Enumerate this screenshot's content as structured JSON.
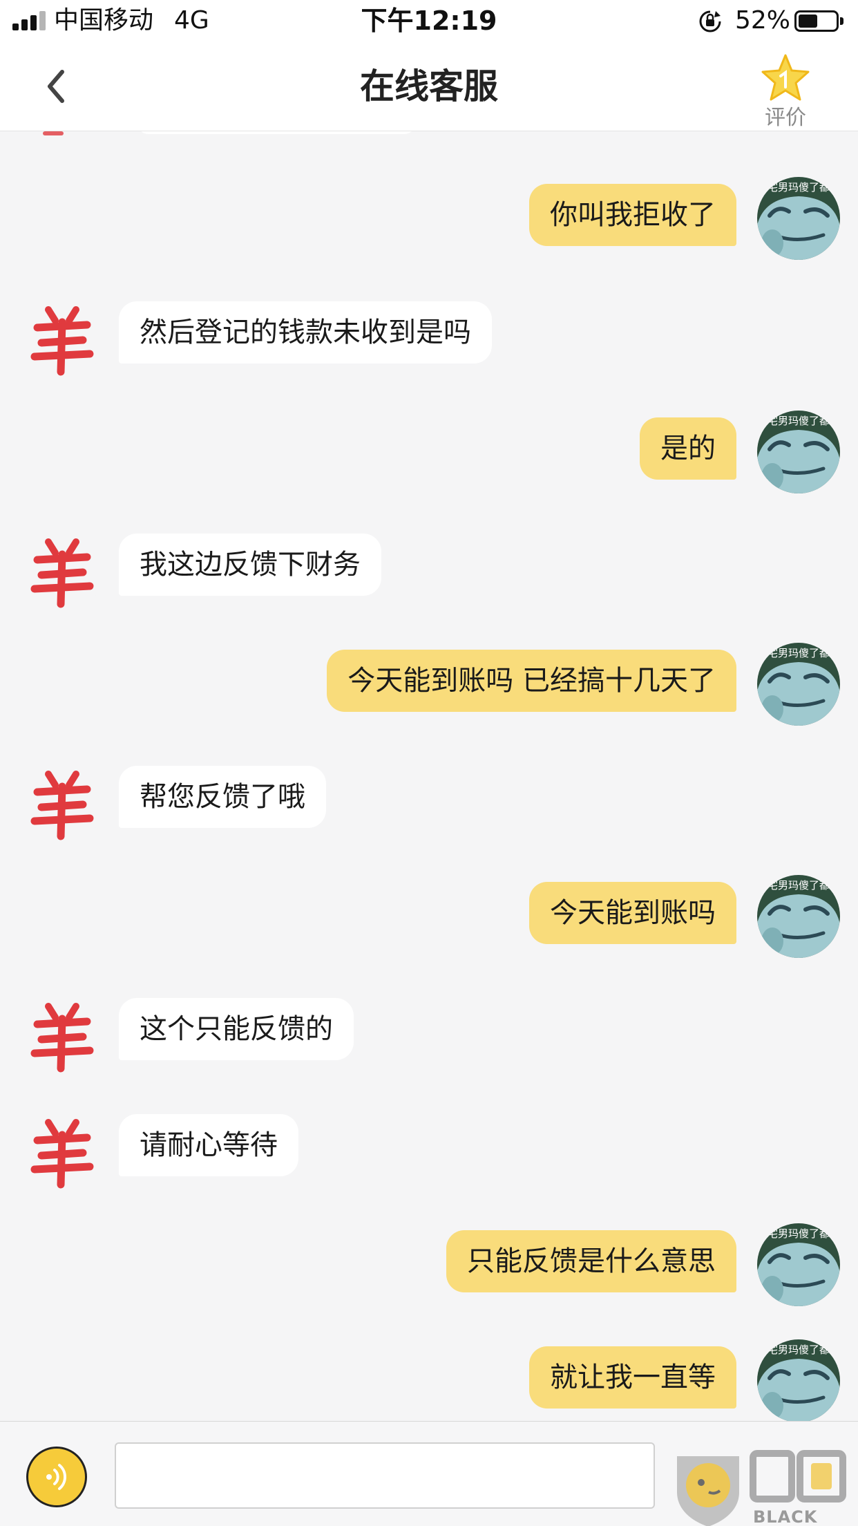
{
  "status_bar": {
    "carrier": "中国移动",
    "network": "4G",
    "time": "下午12:19",
    "battery_percent": "52%",
    "battery_level": 0.52
  },
  "nav": {
    "title": "在线客服",
    "back_icon": "chevron-left-icon",
    "rate_label": "评价",
    "rate_icon": "star-icon"
  },
  "messages": [
    {
      "from": "user",
      "text": "你叫我拒收了"
    },
    {
      "from": "agent",
      "text": "然后登记的钱款未收到是吗"
    },
    {
      "from": "user",
      "text": "是的"
    },
    {
      "from": "agent",
      "text": "我这边反馈下财务"
    },
    {
      "from": "user",
      "text": "今天能到账吗 已经搞十几天了"
    },
    {
      "from": "agent",
      "text": "帮您反馈了哦"
    },
    {
      "from": "user",
      "text": "今天能到账吗"
    },
    {
      "from": "agent",
      "text": "这个只能反馈的"
    },
    {
      "from": "agent",
      "text": "请耐心等待"
    },
    {
      "from": "user",
      "text": "只能反馈是什么意思"
    },
    {
      "from": "user",
      "text": "就让我一直等"
    }
  ],
  "avatar_caption": "宅男玛傻了都",
  "input": {
    "placeholder": "",
    "value": ""
  },
  "watermark": {
    "text": "BLACK CAT"
  },
  "colors": {
    "user_bubble": "#f9dc7b",
    "agent_bubble": "#ffffff",
    "background": "#f5f5f6",
    "accent": "#f6cb3a",
    "agent_logo": "#e03a3e"
  }
}
